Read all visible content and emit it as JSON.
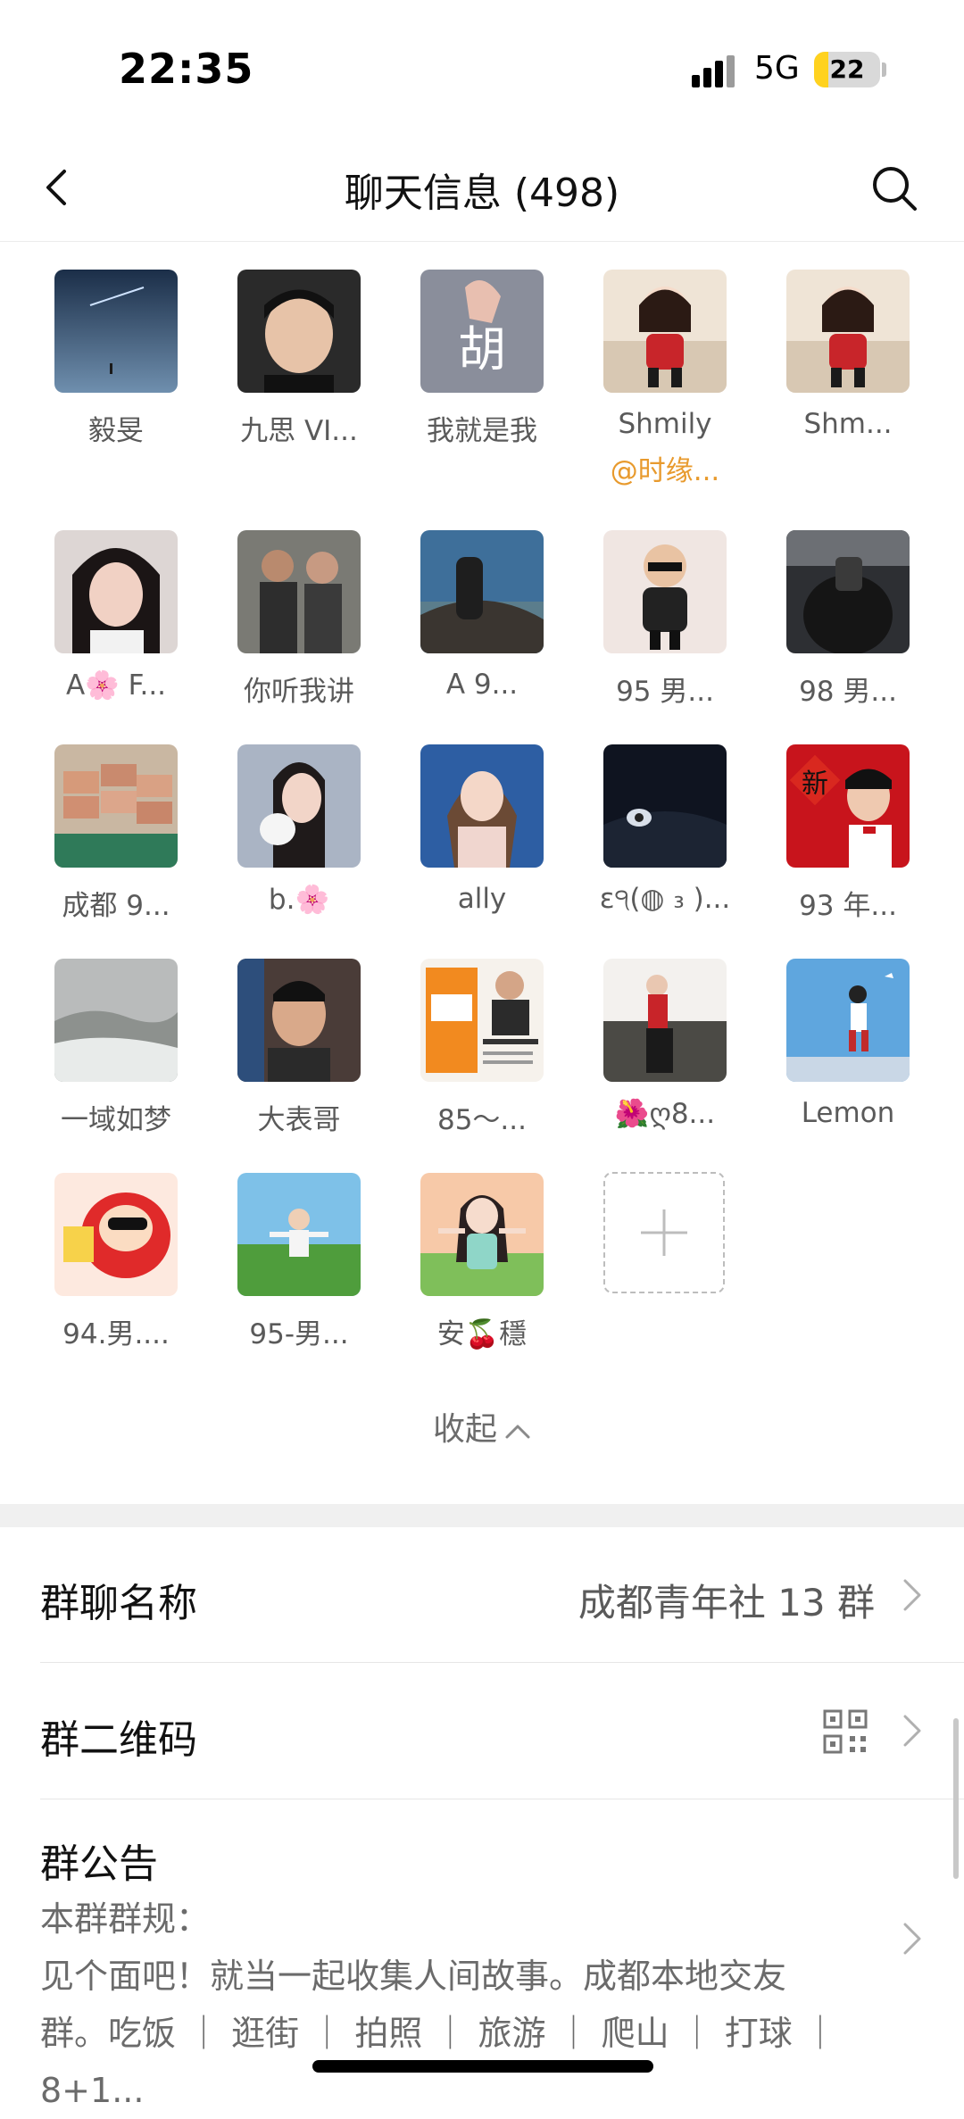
{
  "status_bar": {
    "time": "22:35",
    "network": "5G",
    "battery": "22",
    "battery_level": 0.22
  },
  "nav": {
    "title": "聊天信息 (498)"
  },
  "members": [
    {
      "name": "毅旻",
      "sub": ""
    },
    {
      "name": "九思 VI...",
      "sub": ""
    },
    {
      "name": "我就是我",
      "sub": ""
    },
    {
      "name": "Shmily",
      "sub": "@时缘..."
    },
    {
      "name": "Shm...",
      "sub": ""
    },
    {
      "name": "A🌸  F...",
      "sub": ""
    },
    {
      "name": "你听我讲",
      "sub": ""
    },
    {
      "name": "A     9...",
      "sub": ""
    },
    {
      "name": "95 男...",
      "sub": ""
    },
    {
      "name": "98  男...",
      "sub": ""
    },
    {
      "name": "成都 9...",
      "sub": ""
    },
    {
      "name": "b.🌸",
      "sub": ""
    },
    {
      "name": "ally",
      "sub": ""
    },
    {
      "name": "ε੧(◍ ₃ )...",
      "sub": ""
    },
    {
      "name": "93 年...",
      "sub": ""
    },
    {
      "name": "一域如梦",
      "sub": ""
    },
    {
      "name": "大表哥",
      "sub": ""
    },
    {
      "name": "85～...",
      "sub": ""
    },
    {
      "name": "🌺ღ8...",
      "sub": ""
    },
    {
      "name": "Lemon",
      "sub": ""
    },
    {
      "name": "94.男....",
      "sub": ""
    },
    {
      "name": "95-男...",
      "sub": ""
    },
    {
      "name": "安🍒穩",
      "sub": ""
    }
  ],
  "collapse_label": "收起",
  "settings": {
    "group_name_label": "群聊名称",
    "group_name_value": "成都青年社 13 群",
    "qr_label": "群二维码",
    "notice_label": "群公告",
    "notice_line1": "本群群规：",
    "notice_line2": "见个面吧！就当一起收集人间故事。成都本地交友",
    "notice_line3": "群。吃饭 ｜ 逛街 ｜ 拍照 ｜ 旅游 ｜ 爬山 ｜ 打球 ｜ 8+1..."
  }
}
